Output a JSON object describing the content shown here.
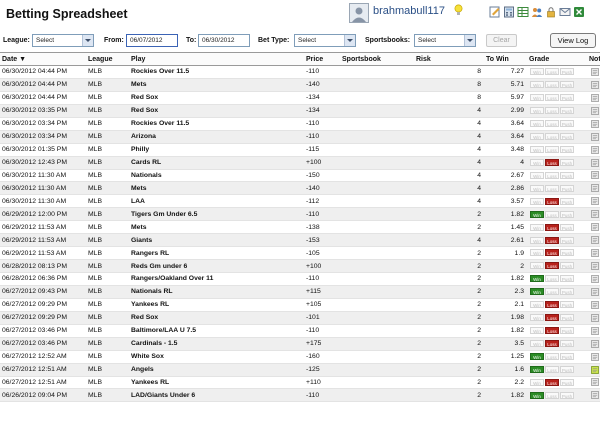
{
  "header": {
    "title": "Betting Spreadsheet",
    "username": "brahmabull117"
  },
  "filters": {
    "league_label": "League:",
    "league_value": "Select",
    "from_label": "From:",
    "from_value": "06/07/2012",
    "to_label": "To:",
    "to_value": "06/30/2012",
    "bettype_label": "Bet Type:",
    "bettype_value": "Select",
    "sportsbooks_label": "Sportsbooks:",
    "sportsbooks_value": "Select",
    "clear_label": "Clear",
    "viewlog_label": "View Log"
  },
  "table": {
    "columns": {
      "date": "Date ▼",
      "league": "League",
      "play": "Play",
      "price": "Price",
      "sportsbook": "Sportsbook",
      "risk": "Risk",
      "towin": "To Win",
      "grade": "Grade",
      "notes": "Notes"
    },
    "grade_labels": {
      "win": "Win",
      "loss": "Loss",
      "push": "Push"
    },
    "rows": [
      {
        "date": "06/30/2012 04:44 PM",
        "league": "MLB",
        "play": "Rockies Over 11.5",
        "price": "-110",
        "sportsbook": "",
        "risk": "8",
        "towin": "7.27",
        "grade": "none"
      },
      {
        "date": "06/30/2012 04:44 PM",
        "league": "MLB",
        "play": "Mets",
        "price": "-140",
        "sportsbook": "",
        "risk": "8",
        "towin": "5.71",
        "grade": "none"
      },
      {
        "date": "06/30/2012 04:44 PM",
        "league": "MLB",
        "play": "Red Sox",
        "price": "-134",
        "sportsbook": "",
        "risk": "8",
        "towin": "5.97",
        "grade": "none"
      },
      {
        "date": "06/30/2012 03:35 PM",
        "league": "MLB",
        "play": "Red Sox",
        "price": "-134",
        "sportsbook": "",
        "risk": "4",
        "towin": "2.99",
        "grade": "none"
      },
      {
        "date": "06/30/2012 03:34 PM",
        "league": "MLB",
        "play": "Rockies Over 11.5",
        "price": "-110",
        "sportsbook": "",
        "risk": "4",
        "towin": "3.64",
        "grade": "none"
      },
      {
        "date": "06/30/2012 03:34 PM",
        "league": "MLB",
        "play": "Arizona",
        "price": "-110",
        "sportsbook": "",
        "risk": "4",
        "towin": "3.64",
        "grade": "none"
      },
      {
        "date": "06/30/2012 01:35 PM",
        "league": "MLB",
        "play": "Philly",
        "price": "-115",
        "sportsbook": "",
        "risk": "4",
        "towin": "3.48",
        "grade": "none"
      },
      {
        "date": "06/30/2012 12:43 PM",
        "league": "MLB",
        "play": "Cards RL",
        "price": "+100",
        "sportsbook": "",
        "risk": "4",
        "towin": "4",
        "grade": "loss"
      },
      {
        "date": "06/30/2012 11:30 AM",
        "league": "MLB",
        "play": "Nationals",
        "price": "-150",
        "sportsbook": "",
        "risk": "4",
        "towin": "2.67",
        "grade": "none"
      },
      {
        "date": "06/30/2012 11:30 AM",
        "league": "MLB",
        "play": "Mets",
        "price": "-140",
        "sportsbook": "",
        "risk": "4",
        "towin": "2.86",
        "grade": "none"
      },
      {
        "date": "06/30/2012 11:30 AM",
        "league": "MLB",
        "play": "LAA",
        "price": "-112",
        "sportsbook": "",
        "risk": "4",
        "towin": "3.57",
        "grade": "loss"
      },
      {
        "date": "06/29/2012 12:00 PM",
        "league": "MLB",
        "play": "Tigers Gm Under 6.5",
        "price": "-110",
        "sportsbook": "",
        "risk": "2",
        "towin": "1.82",
        "grade": "win"
      },
      {
        "date": "06/29/2012 11:53 AM",
        "league": "MLB",
        "play": "Mets",
        "price": "-138",
        "sportsbook": "",
        "risk": "2",
        "towin": "1.45",
        "grade": "loss"
      },
      {
        "date": "06/29/2012 11:53 AM",
        "league": "MLB",
        "play": "Giants",
        "price": "-153",
        "sportsbook": "",
        "risk": "4",
        "towin": "2.61",
        "grade": "loss"
      },
      {
        "date": "06/29/2012 11:53 AM",
        "league": "MLB",
        "play": "Rangers RL",
        "price": "-105",
        "sportsbook": "",
        "risk": "2",
        "towin": "1.9",
        "grade": "loss"
      },
      {
        "date": "06/28/2012 08:13 PM",
        "league": "MLB",
        "play": "Reds Gm under 6",
        "price": "+100",
        "sportsbook": "",
        "risk": "2",
        "towin": "2",
        "grade": "loss"
      },
      {
        "date": "06/28/2012 06:36 PM",
        "league": "MLB",
        "play": "Rangers/Oakland Over 11",
        "price": "-110",
        "sportsbook": "",
        "risk": "2",
        "towin": "1.82",
        "grade": "win"
      },
      {
        "date": "06/27/2012 09:43 PM",
        "league": "MLB",
        "play": "Nationals RL",
        "price": "+115",
        "sportsbook": "",
        "risk": "2",
        "towin": "2.3",
        "grade": "win"
      },
      {
        "date": "06/27/2012 09:29 PM",
        "league": "MLB",
        "play": "Yankees RL",
        "price": "+105",
        "sportsbook": "",
        "risk": "2",
        "towin": "2.1",
        "grade": "loss"
      },
      {
        "date": "06/27/2012 09:29 PM",
        "league": "MLB",
        "play": "Red Sox",
        "price": "-101",
        "sportsbook": "",
        "risk": "2",
        "towin": "1.98",
        "grade": "loss"
      },
      {
        "date": "06/27/2012 03:46 PM",
        "league": "MLB",
        "play": "Baltimore/LAA U 7.5",
        "price": "-110",
        "sportsbook": "",
        "risk": "2",
        "towin": "1.82",
        "grade": "loss"
      },
      {
        "date": "06/27/2012 03:46 PM",
        "league": "MLB",
        "play": "Cardinals - 1.5",
        "price": "+175",
        "sportsbook": "",
        "risk": "2",
        "towin": "3.5",
        "grade": "loss"
      },
      {
        "date": "06/27/2012 12:52 AM",
        "league": "MLB",
        "play": "White Sox",
        "price": "-160",
        "sportsbook": "",
        "risk": "2",
        "towin": "1.25",
        "grade": "win"
      },
      {
        "date": "06/27/2012 12:51 AM",
        "league": "MLB",
        "play": "Angels",
        "price": "-125",
        "sportsbook": "",
        "risk": "2",
        "towin": "1.6",
        "grade": "win",
        "note_active": true
      },
      {
        "date": "06/27/2012 12:51 AM",
        "league": "MLB",
        "play": "Yankees RL",
        "price": "+110",
        "sportsbook": "",
        "risk": "2",
        "towin": "2.2",
        "grade": "loss"
      },
      {
        "date": "06/26/2012 09:04 PM",
        "league": "MLB",
        "play": "LAD/Giants Under 6",
        "price": "-110",
        "sportsbook": "",
        "risk": "2",
        "towin": "1.82",
        "grade": "win"
      }
    ]
  }
}
